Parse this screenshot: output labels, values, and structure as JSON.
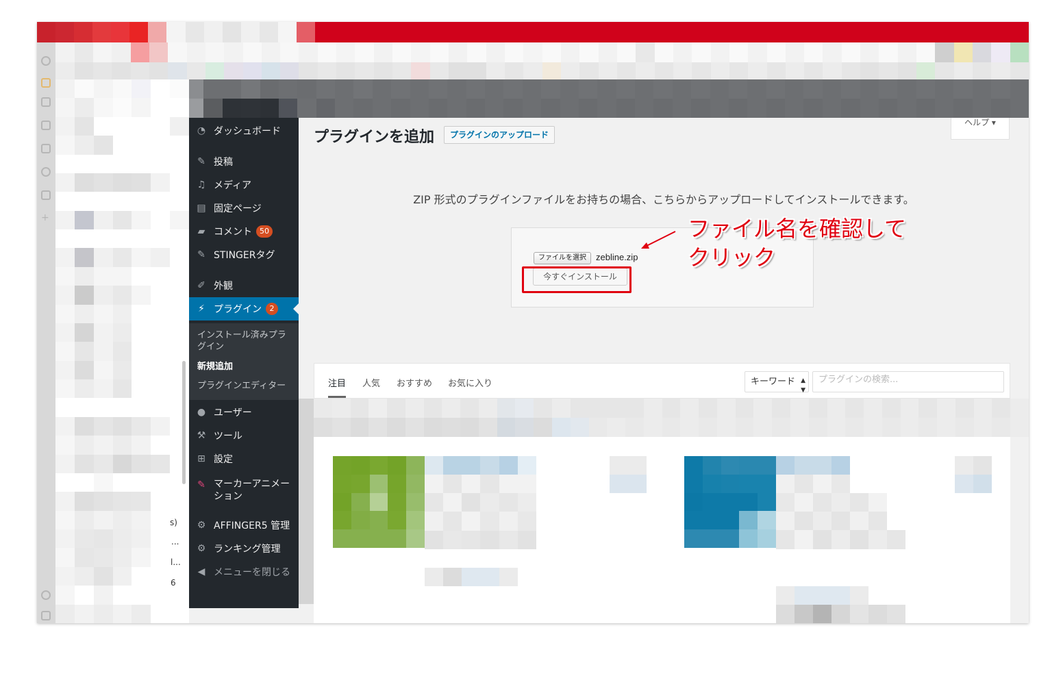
{
  "page": {
    "title": "プラグインを追加",
    "upload_button": "プラグインのアップロード",
    "help_label": "ヘルプ ▾",
    "description": "ZIP 形式のプラグインファイルをお持ちの場合、こちらからアップロードしてインストールできます。"
  },
  "upload": {
    "choose_file_label": "ファイルを選択",
    "file_name": "zebline.zip",
    "install_now_label": "今すぐインストール"
  },
  "annotation": {
    "line1": "ファイル名を確認して",
    "line2": "クリック",
    "color": "#e00010"
  },
  "menu": {
    "items": [
      {
        "label": "ダッシュボード",
        "icon": "dashboard-icon"
      },
      {
        "label": "投稿",
        "icon": "pin-icon"
      },
      {
        "label": "メディア",
        "icon": "media-icon"
      },
      {
        "label": "固定ページ",
        "icon": "page-icon"
      },
      {
        "label": "コメント",
        "icon": "comment-icon",
        "badge": "50"
      },
      {
        "label": "STINGERタグ",
        "icon": "pin-icon"
      },
      {
        "label": "外観",
        "icon": "brush-icon"
      },
      {
        "label": "プラグイン",
        "icon": "plug-icon",
        "badge": "2"
      },
      {
        "label": "ユーザー",
        "icon": "user-icon"
      },
      {
        "label": "ツール",
        "icon": "wrench-icon"
      },
      {
        "label": "設定",
        "icon": "settings-icon"
      },
      {
        "label": "マーカーアニメーション",
        "icon": "marker-icon"
      },
      {
        "label": "AFFINGER5 管理",
        "icon": "gear-icon"
      },
      {
        "label": "ランキング管理",
        "icon": "gear-icon"
      },
      {
        "label": "メニューを閉じる",
        "icon": "collapse-icon"
      }
    ],
    "submenu": [
      {
        "label": "インストール済みプラグイン"
      },
      {
        "label": "新規追加"
      },
      {
        "label": "プラグインエディター"
      }
    ]
  },
  "filters": {
    "tabs": [
      {
        "label": "注目"
      },
      {
        "label": "人気"
      },
      {
        "label": "おすすめ"
      },
      {
        "label": "お気に入り"
      }
    ],
    "search_type": "キーワード",
    "search_placeholder": "プラグインの検索..."
  },
  "sidebar_fragments": [
    "s)",
    "...",
    "l...",
    "6"
  ],
  "colors": {
    "accent": "#0073aa",
    "menu_bg": "#23282d",
    "badge": "#d54e21",
    "browser_bar": "#d0021b"
  }
}
